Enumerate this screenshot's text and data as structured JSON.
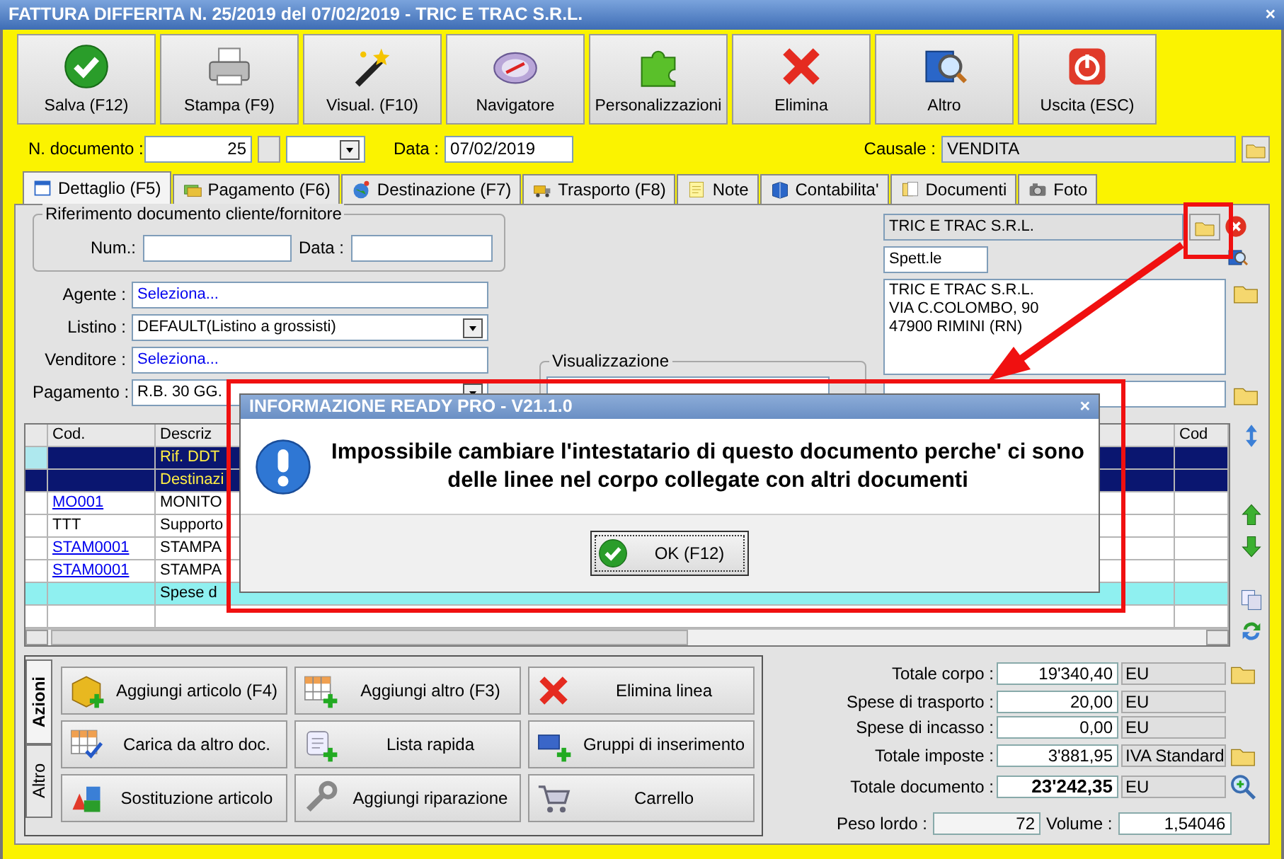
{
  "window": {
    "title": "FATTURA DIFFERITA N. 25/2019 del 07/02/2019 - TRIC E TRAC S.R.L.",
    "close": "×"
  },
  "toolbar": [
    "Salva (F12)",
    "Stampa (F9)",
    "Visual. (F10)",
    "Navigatore",
    "Personalizzazioni",
    "Elimina",
    "Altro",
    "Uscita (ESC)"
  ],
  "header": {
    "number_label": "N. documento :",
    "number": "25",
    "date_label": "Data :",
    "date": "07/02/2019",
    "causale_label": "Causale :",
    "causale": "VENDITA"
  },
  "tabs": [
    {
      "label": "Dettaglio (F5)",
      "selected": true
    },
    {
      "label": "Pagamento (F6)",
      "selected": false
    },
    {
      "label": "Destinazione (F7)",
      "selected": false
    },
    {
      "label": "Trasporto (F8)",
      "selected": false
    },
    {
      "label": "Note",
      "selected": false
    },
    {
      "label": "Contabilita'",
      "selected": false
    },
    {
      "label": "Documenti",
      "selected": false
    },
    {
      "label": "Foto",
      "selected": false
    }
  ],
  "reference": {
    "legend": "Riferimento documento cliente/fornitore",
    "num_label": "Num.:",
    "date_label": "Data :"
  },
  "fields": [
    {
      "label": "Agente :",
      "value": "Seleziona...",
      "kind": "link"
    },
    {
      "label": "Listino :",
      "value": "DEFAULT(Listino a grossisti)",
      "kind": "select"
    },
    {
      "label": "Venditore :",
      "value": "Seleziona...",
      "kind": "link"
    },
    {
      "label": "Pagamento :",
      "value": "R.B. 30 GG.",
      "kind": "select"
    }
  ],
  "view": {
    "legend": "Visualizzazione"
  },
  "customer": {
    "name": "TRIC E TRAC S.R.L.",
    "salutation": "Spett.le",
    "address": [
      "TRIC E TRAC S.R.L.",
      "VIA C.COLOMBO, 90",
      "47900 RIMINI (RN)"
    ]
  },
  "table": {
    "columns": [
      "Cod.",
      "Descriz",
      "Cod"
    ],
    "rows": [
      {
        "code": "",
        "description": "Rif. DDT",
        "kind": "reference",
        "selected": true
      },
      {
        "code": "",
        "description": "Destinazi",
        "kind": "reference",
        "selected": false
      },
      {
        "code": "MO001",
        "description": "MONITO",
        "kind": "item",
        "link": true,
        "selected": false
      },
      {
        "code": "TTT",
        "description": "Supporto",
        "kind": "item",
        "link": false,
        "selected": false
      },
      {
        "code": "STAM0001",
        "description": "STAMPA",
        "kind": "item",
        "link": true,
        "selected": false
      },
      {
        "code": "STAM0001",
        "description": "STAMPA",
        "kind": "item",
        "link": true,
        "selected": false
      },
      {
        "code": "",
        "description": "Spese d",
        "kind": "expense",
        "selected": false
      }
    ]
  },
  "dialog": {
    "title": "INFORMAZIONE READY PRO - V21.1.0",
    "close": "×",
    "message": "Impossibile cambiare l'intestatario di questo documento perche' ci sono delle linee nel corpo collegate con altri documenti",
    "button": "OK (F12)"
  },
  "actions": {
    "tabs": [
      {
        "label": "Azioni",
        "selected": true
      },
      {
        "label": "Altro",
        "selected": false
      }
    ],
    "buttons": [
      "Aggiungi articolo (F4)",
      "Aggiungi altro (F3)",
      "Elimina linea",
      "Carica da altro doc.",
      "Lista rapida",
      "Gruppi di inserimento",
      "Sostituzione articolo",
      "Aggiungi riparazione",
      "Carrello"
    ]
  },
  "totals": [
    {
      "label": "Totale corpo :",
      "value": "19'340,40",
      "unit": "EU",
      "bold": false
    },
    {
      "label": "Spese di trasporto :",
      "value": "20,00",
      "unit": "EU",
      "bold": false
    },
    {
      "label": "Spese di incasso :",
      "value": "0,00",
      "unit": "EU",
      "bold": false
    },
    {
      "label": "Totale imposte :",
      "value": "3'881,95",
      "unit": "IVA Standard",
      "bold": false
    },
    {
      "label": "Totale documento :",
      "value": "23'242,35",
      "unit": "EU",
      "bold": true
    }
  ],
  "weights": {
    "gross_label": "Peso lordo :",
    "gross": "72",
    "volume_label": "Volume :",
    "volume": "1,54046"
  }
}
